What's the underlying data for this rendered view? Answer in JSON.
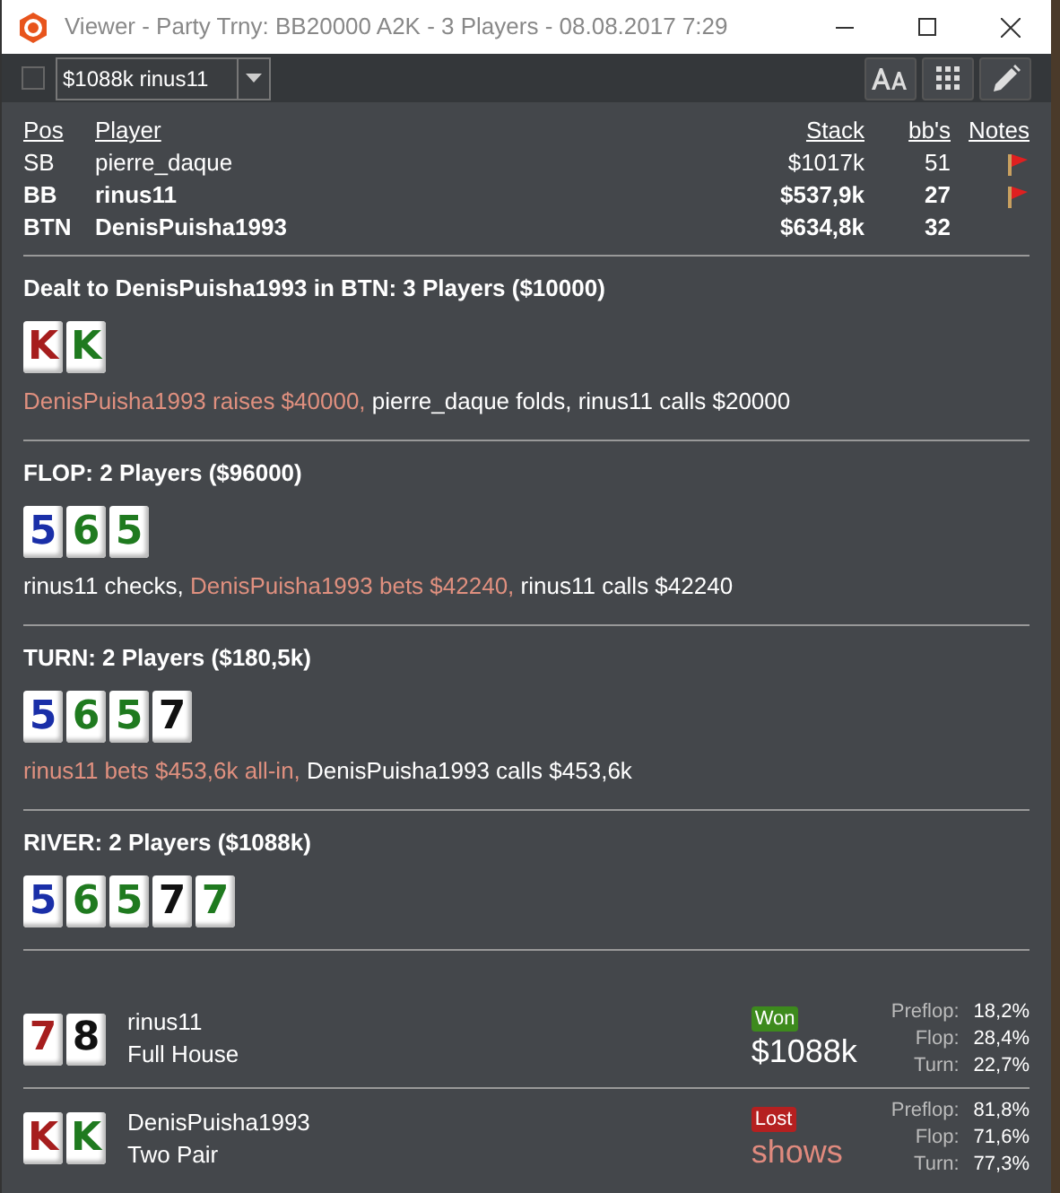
{
  "window": {
    "title": "Viewer - Party Trny: BB20000 A2K - 3 Players - 08.08.2017 7:29"
  },
  "toolbar": {
    "checkbox": {
      "checked": false
    },
    "hand_select": {
      "value": "$1088k rinus11"
    },
    "buttons": [
      {
        "kind": "font"
      },
      {
        "kind": "grid"
      },
      {
        "kind": "edit"
      }
    ]
  },
  "players_table": {
    "columns": [
      "Pos",
      "Player",
      "Stack",
      "bb's",
      "Notes"
    ],
    "rows": [
      {
        "pos": "SB",
        "player": "pierre_daque",
        "stack": "$1017k",
        "bbs": "51",
        "note": true,
        "bold": false
      },
      {
        "pos": "BB",
        "player": "rinus11",
        "stack": "$537,9k",
        "bbs": "27",
        "note": true,
        "bold": true
      },
      {
        "pos": "BTN",
        "player": "DenisPuisha1993",
        "stack": "$634,8k",
        "bbs": "32",
        "note": false,
        "bold": true
      }
    ]
  },
  "streets": [
    {
      "title": "Dealt to DenisPuisha1993 in BTN: 3 Players ($10000)",
      "cards": [
        {
          "rank": "K",
          "color": "#a61e1e"
        },
        {
          "rank": "K",
          "color": "#1f7a1f"
        }
      ],
      "actions": [
        {
          "text": "DenisPuisha1993 raises $40000,",
          "hero": true
        },
        {
          "text": "pierre_daque folds, rinus11 calls $20000",
          "hero": false
        }
      ]
    },
    {
      "title": "FLOP: 2 Players ($96000)",
      "cards": [
        {
          "rank": "5",
          "color": "#1a2fa8"
        },
        {
          "rank": "6",
          "color": "#1f7a1f"
        },
        {
          "rank": "5",
          "color": "#1f7a1f"
        }
      ],
      "actions": [
        {
          "text": "rinus11 checks,",
          "hero": false
        },
        {
          "text": "DenisPuisha1993 bets $42240,",
          "hero": true
        },
        {
          "text": "rinus11 calls $42240",
          "hero": false
        }
      ]
    },
    {
      "title": "TURN: 2 Players ($180,5k)",
      "cards": [
        {
          "rank": "5",
          "color": "#1a2fa8"
        },
        {
          "rank": "6",
          "color": "#1f7a1f"
        },
        {
          "rank": "5",
          "color": "#1f7a1f"
        },
        {
          "rank": "7",
          "color": "#111111"
        }
      ],
      "actions": [
        {
          "text": "rinus11 bets $453,6k all-in,",
          "hero": true
        },
        {
          "text": "DenisPuisha1993 calls $453,6k",
          "hero": false
        }
      ]
    },
    {
      "title": "RIVER: 2 Players ($1088k)",
      "cards": [
        {
          "rank": "5",
          "color": "#1a2fa8"
        },
        {
          "rank": "6",
          "color": "#1f7a1f"
        },
        {
          "rank": "5",
          "color": "#1f7a1f"
        },
        {
          "rank": "7",
          "color": "#111111"
        },
        {
          "rank": "7",
          "color": "#1f7a1f"
        }
      ]
    }
  ],
  "results": [
    {
      "cards": [
        {
          "rank": "7",
          "color": "#a61e1e"
        },
        {
          "rank": "8",
          "color": "#111111"
        }
      ],
      "player": "rinus11",
      "hand": "Full House",
      "won": true,
      "badge": "Won",
      "amount": "$1088k",
      "equity": [
        {
          "label": "Preflop:",
          "value": "18,2%"
        },
        {
          "label": "Flop:",
          "value": "28,4%"
        },
        {
          "label": "Turn:",
          "value": "22,7%"
        }
      ]
    },
    {
      "cards": [
        {
          "rank": "K",
          "color": "#a61e1e"
        },
        {
          "rank": "K",
          "color": "#1f7a1f"
        }
      ],
      "player": "DenisPuisha1993",
      "hand": "Two Pair",
      "won": false,
      "badge": "Lost",
      "amount": "shows",
      "equity": [
        {
          "label": "Preflop:",
          "value": "81,8%"
        },
        {
          "label": "Flop:",
          "value": "71,6%"
        },
        {
          "label": "Turn:",
          "value": "77,3%"
        }
      ]
    }
  ]
}
